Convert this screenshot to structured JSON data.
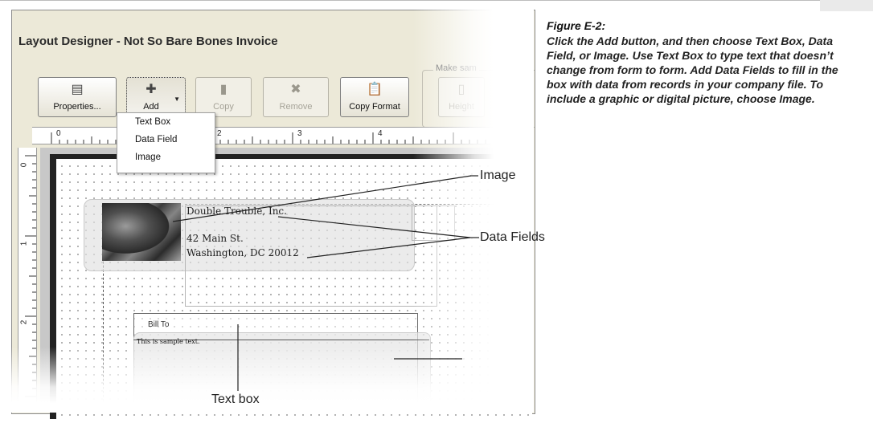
{
  "window": {
    "title": "Layout Designer - Not So Bare Bones Invoice"
  },
  "toolbar": {
    "properties_label": "Properties...",
    "add_label": "Add",
    "copy_label": "Copy",
    "remove_label": "Remove",
    "copy_format_label": "Copy Format",
    "height_label": "Height",
    "group_caption": "Make sam"
  },
  "add_menu": {
    "items": [
      "Text Box",
      "Data Field",
      "Image"
    ]
  },
  "ruler": {
    "h_marks": [
      "0",
      "1",
      "2",
      "3",
      "4"
    ],
    "v_marks": [
      "0",
      "1",
      "2"
    ]
  },
  "form": {
    "company_name": "Double Trouble, Inc.",
    "address_line1": "42 Main St.",
    "address_line2": "Washington, DC 20012",
    "bill_to_label": "Bill To",
    "sample_text": "This is sample text."
  },
  "callouts": {
    "image": "Image",
    "data_fields": "Data Fields",
    "text_box": "Text box"
  },
  "caption": {
    "title": "Figure E-2:",
    "body": "Click the Add button, and then choose Text Box, Data Field, or Image. Use Text Box to type text that doesn’t change from form to form. Add Data Fields to fill in the box with data from records in your company file. To include a graphic or digital picture, choose Image."
  }
}
